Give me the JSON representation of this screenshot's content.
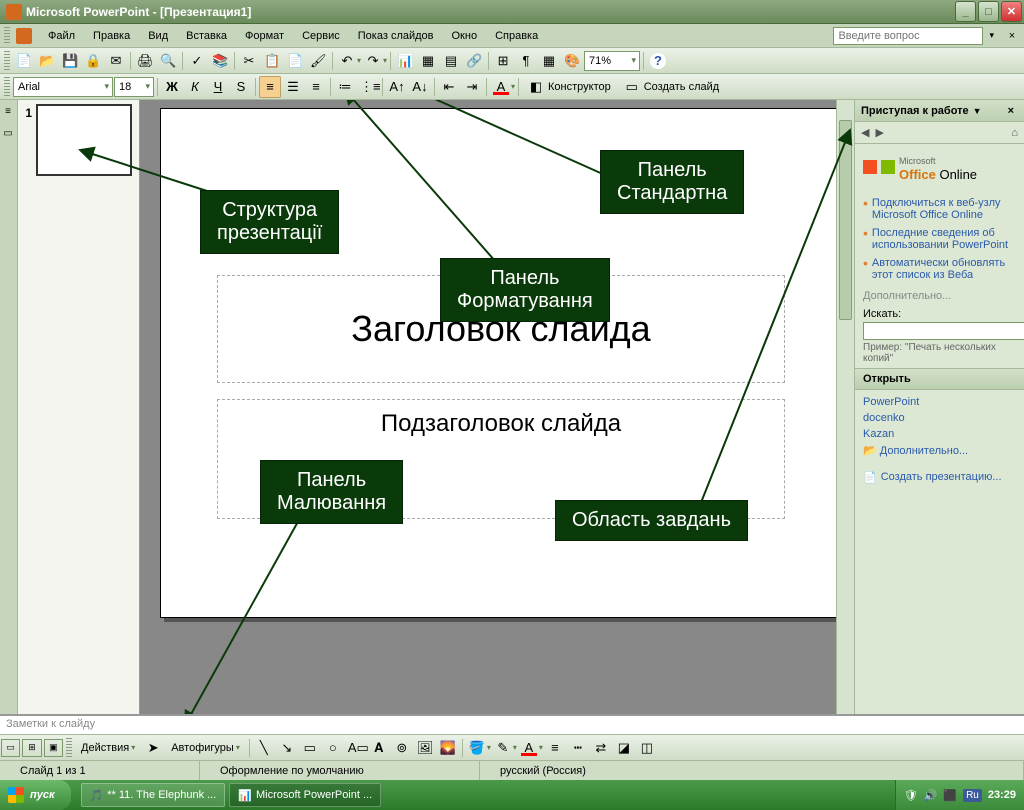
{
  "title": "Microsoft PowerPoint - [Презентация1]",
  "menus": [
    "Файл",
    "Правка",
    "Вид",
    "Вставка",
    "Формат",
    "Сервис",
    "Показ слайдов",
    "Окно",
    "Справка"
  ],
  "ask_placeholder": "Введите вопрос",
  "font_name": "Arial",
  "font_size": "18",
  "zoom": "71%",
  "designer_label": "Конструктор",
  "new_slide_label": "Создать слайд",
  "slide_number": "1",
  "slide_title": "Заголовок слайда",
  "slide_subtitle": "Подзаголовок слайда",
  "callouts": {
    "standard": "Панель\nСтандартна",
    "structure": "Структура\nпрезентації",
    "format": "Панель\nФорматування",
    "drawing": "Панель\nМалювання",
    "tasks": "Область завдань"
  },
  "notes_placeholder": "Заметки к слайду",
  "taskpane": {
    "header": "Приступая к работе",
    "office_online": "Office Online",
    "office_brand": "Microsoft",
    "links": [
      "Подключиться к веб-узлу Microsoft Office Online",
      "Последние сведения об использовании PowerPoint",
      "Автоматически обновлять этот список из Веба"
    ],
    "more": "Дополнительно...",
    "search_label": "Искать:",
    "example": "Пример:  \"Печать нескольких копий\"",
    "open_header": "Открыть",
    "recent": [
      "PowerPoint",
      "docenko",
      "Kazan"
    ],
    "open_more": "Дополнительно...",
    "create": "Создать презентацию..."
  },
  "drawbar": {
    "actions": "Действия",
    "autoshapes": "Автофигуры"
  },
  "status": {
    "slide": "Слайд 1 из 1",
    "design": "Оформление по умолчанию",
    "lang": "русский (Россия)"
  },
  "taskbar": {
    "start": "пуск",
    "tasks": [
      "** 11. The Elephunk ...",
      "Microsoft PowerPoint ..."
    ],
    "lang": "Ru",
    "time": "23:29"
  }
}
